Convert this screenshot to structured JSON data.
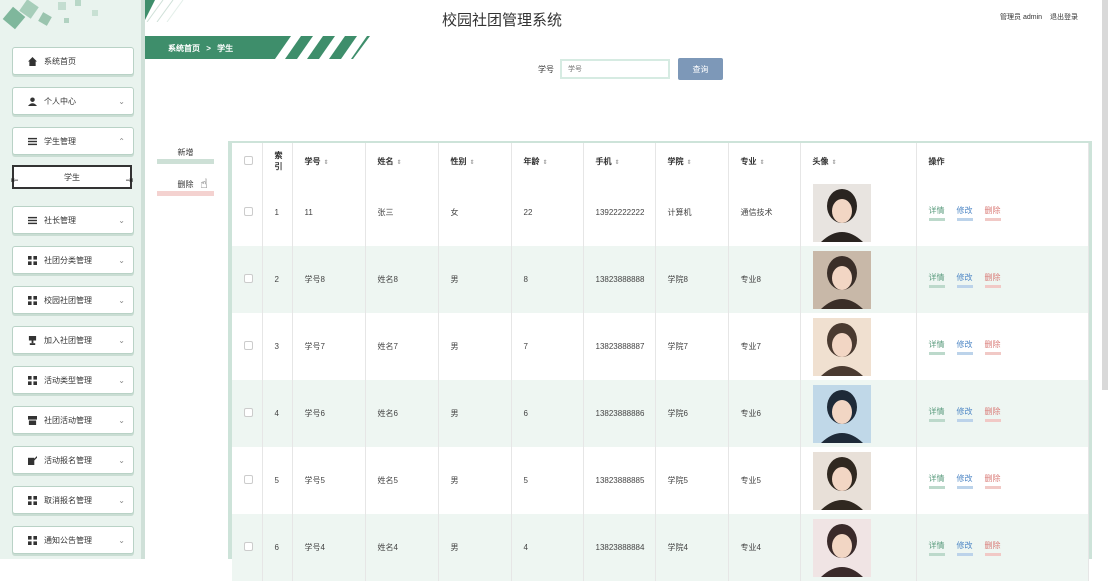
{
  "header": {
    "system_title": "校园社团管理系统",
    "user_role": "管理员 admin",
    "logout": "退出登录"
  },
  "breadcrumb": {
    "home": "系统首页",
    "separator": ">",
    "current": "学生"
  },
  "sidebar": {
    "items": [
      {
        "label": "系统首页",
        "icon": "home-icon",
        "chevron": false
      },
      {
        "label": "个人中心",
        "icon": "user-icon",
        "chevron": true
      },
      {
        "label": "学生管理",
        "icon": "list-icon",
        "chevron": true,
        "expanded": true
      },
      {
        "label": "社长管理",
        "icon": "list-icon",
        "chevron": true
      },
      {
        "label": "社团分类管理",
        "icon": "grid-icon",
        "chevron": true
      },
      {
        "label": "校园社团管理",
        "icon": "grid-icon",
        "chevron": true
      },
      {
        "label": "加入社团管理",
        "icon": "trophy-icon",
        "chevron": true
      },
      {
        "label": "活动类型管理",
        "icon": "grid-icon",
        "chevron": true
      },
      {
        "label": "社团活动管理",
        "icon": "box-icon",
        "chevron": true
      },
      {
        "label": "活动报名管理",
        "icon": "edit-icon",
        "chevron": true
      },
      {
        "label": "取消报名管理",
        "icon": "grid-icon",
        "chevron": true
      },
      {
        "label": "通知公告管理",
        "icon": "grid-icon",
        "chevron": true
      }
    ],
    "submenu_active": "学生"
  },
  "search": {
    "label": "学号",
    "placeholder": "学号",
    "button": "查询"
  },
  "actions": {
    "add": "新增",
    "delete": "删除"
  },
  "table": {
    "headers": [
      "索引",
      "学号",
      "姓名",
      "性别",
      "年龄",
      "手机",
      "学院",
      "专业",
      "头像",
      "操作"
    ],
    "index_header_lines": [
      "索",
      "引"
    ],
    "rows": [
      {
        "index": "1",
        "id": "11",
        "name": "张三",
        "gender": "女",
        "age": "22",
        "phone": "13922222222",
        "college": "计算机",
        "major": "通信技术"
      },
      {
        "index": "2",
        "id": "学号8",
        "name": "姓名8",
        "gender": "男",
        "age": "8",
        "phone": "13823888888",
        "college": "学院8",
        "major": "专业8"
      },
      {
        "index": "3",
        "id": "学号7",
        "name": "姓名7",
        "gender": "男",
        "age": "7",
        "phone": "13823888887",
        "college": "学院7",
        "major": "专业7"
      },
      {
        "index": "4",
        "id": "学号6",
        "name": "姓名6",
        "gender": "男",
        "age": "6",
        "phone": "13823888886",
        "college": "学院6",
        "major": "专业6"
      },
      {
        "index": "5",
        "id": "学号5",
        "name": "姓名5",
        "gender": "男",
        "age": "5",
        "phone": "13823888885",
        "college": "学院5",
        "major": "专业5"
      },
      {
        "index": "6",
        "id": "学号4",
        "name": "姓名4",
        "gender": "男",
        "age": "4",
        "phone": "13823888884",
        "college": "学院4",
        "major": "专业4"
      }
    ],
    "ops": {
      "detail": "详情",
      "edit": "修改",
      "delete": "删除"
    }
  },
  "colors": {
    "accent_green": "#3e8e6b",
    "search_button": "#7d98b8",
    "detail": "#5a9b7d",
    "edit": "#4d86c5",
    "delete": "#d97a76"
  }
}
